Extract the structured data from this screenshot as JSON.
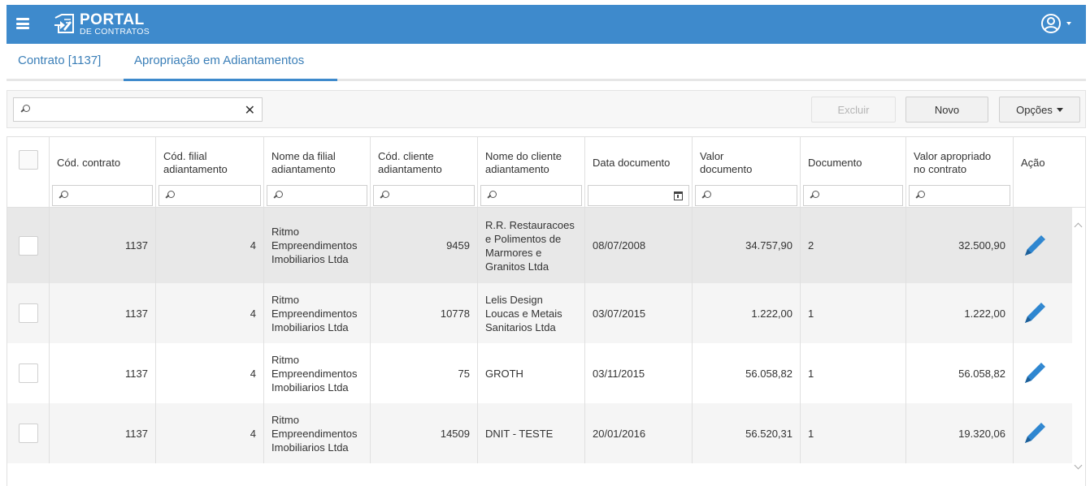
{
  "app": {
    "logo_main": "PORTAL",
    "logo_sub": "DE CONTRATOS"
  },
  "tabs": [
    {
      "label": "Contrato [1137]",
      "active": false
    },
    {
      "label": "Apropriação em Adiantamentos",
      "active": true
    }
  ],
  "toolbar": {
    "search_value": "",
    "excluir_label": "Excluir",
    "excluir_enabled": false,
    "novo_label": "Novo",
    "opcoes_label": "Opções"
  },
  "grid": {
    "columns": [
      {
        "key": "select",
        "label": ""
      },
      {
        "key": "cod_contrato",
        "label": "Cód. contrato"
      },
      {
        "key": "cod_filial",
        "label": "Cód. filial adiantamento",
        "lines": [
          "Cód. filial",
          "adiantamento"
        ]
      },
      {
        "key": "nome_filial",
        "label": "Nome da filial adiantamento",
        "lines": [
          "Nome da filial",
          "adiantamento"
        ]
      },
      {
        "key": "cod_cliente",
        "label": "Cód. cliente adiantamento",
        "lines": [
          "Cód. cliente",
          "adiantamento"
        ]
      },
      {
        "key": "nome_cliente",
        "label": "Nome do cliente adiantamento",
        "lines": [
          "Nome do cliente",
          "adiantamento"
        ]
      },
      {
        "key": "data_documento",
        "label": "Data documento"
      },
      {
        "key": "valor_documento",
        "label": "Valor documento",
        "lines": [
          "Valor",
          "documento"
        ]
      },
      {
        "key": "documento",
        "label": "Documento"
      },
      {
        "key": "valor_apropriado",
        "label": "Valor apropriado no contrato",
        "lines": [
          "Valor apropriado",
          "no contrato"
        ]
      },
      {
        "key": "acao",
        "label": "Ação"
      }
    ],
    "rows": [
      {
        "cod_contrato": "1137",
        "cod_filial": "4",
        "nome_filial": [
          "Ritmo",
          "Empreendimentos",
          "Imobiliarios Ltda"
        ],
        "cod_cliente": "9459",
        "nome_cliente": [
          "R.R. Restauracoes",
          "e Polimentos de",
          "Marmores e",
          "Granitos Ltda"
        ],
        "data_documento": "08/07/2008",
        "valor_documento": "34.757,90",
        "documento": "2",
        "valor_apropriado": "32.500,90",
        "highlight": true
      },
      {
        "cod_contrato": "1137",
        "cod_filial": "4",
        "nome_filial": [
          "Ritmo",
          "Empreendimentos",
          "Imobiliarios Ltda"
        ],
        "cod_cliente": "10778",
        "nome_cliente": [
          "Lelis Design",
          "Loucas e Metais",
          "Sanitarios Ltda"
        ],
        "data_documento": "03/07/2015",
        "valor_documento": "1.222,00",
        "documento": "1",
        "valor_apropriado": "1.222,00",
        "highlight": false
      },
      {
        "cod_contrato": "1137",
        "cod_filial": "4",
        "nome_filial": [
          "Ritmo",
          "Empreendimentos",
          "Imobiliarios Ltda"
        ],
        "cod_cliente": "75",
        "nome_cliente": [
          "GROTH"
        ],
        "data_documento": "03/11/2015",
        "valor_documento": "56.058,82",
        "documento": "1",
        "valor_apropriado": "56.058,82",
        "highlight": false
      },
      {
        "cod_contrato": "1137",
        "cod_filial": "4",
        "nome_filial": [
          "Ritmo",
          "Empreendimentos",
          "Imobiliarios Ltda"
        ],
        "cod_cliente": "14509",
        "nome_cliente": [
          "DNIT - TESTE"
        ],
        "data_documento": "20/01/2016",
        "valor_documento": "56.520,31",
        "documento": "1",
        "valor_apropriado": "19.320,06",
        "highlight": false
      }
    ]
  },
  "colors": {
    "header_blue": "#3e8acc",
    "tab_text": "#3b7fb8",
    "pencil_blue": "#2e86d0",
    "row_selected": "#e8e8e8",
    "row_striped": "#f5f5f5"
  },
  "icons": {
    "menu": "hamburger-icon",
    "logo": "contract-document-icon",
    "user": "user-circle-icon",
    "search": "search-icon",
    "clear": "close-icon",
    "calendar": "calendar-icon",
    "edit": "pencil-icon"
  }
}
